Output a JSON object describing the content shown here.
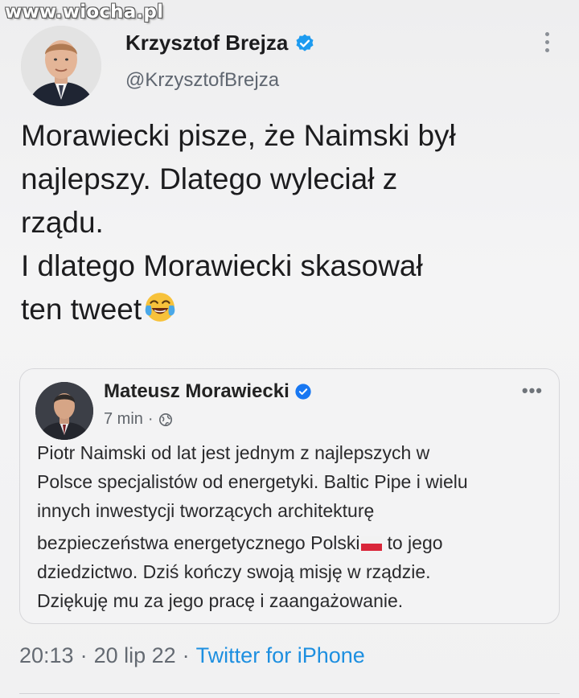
{
  "watermark": "www.wiocha.pl",
  "tweet": {
    "author_name": "Krzysztof Brejza",
    "author_handle": "@KrzysztofBrejza",
    "text_lines": [
      "Morawiecki pisze, że Naimski był",
      "najlepszy. Dlatego wyleciał z",
      "rządu.",
      "I dlatego Morawiecki skasował",
      "ten tweet"
    ],
    "emoji": "face-with-tears-of-joy-icon",
    "time": "20:13",
    "date": "20 lip 22",
    "source": "Twitter for iPhone",
    "separator": "·"
  },
  "quoted_post": {
    "author_name": "Mateusz Morawiecki",
    "time_ago": "7 min",
    "meta_separator": "·",
    "privacy_icon": "globe-icon",
    "more_label": "•••",
    "text_lines": [
      "Piotr Naimski od lat jest jednym z najlepszych w",
      "Polsce specjalistów od energetyki. Baltic Pipe i wielu",
      "innych inwestycji tworzących architekturę",
      "bezpieczeństwa energetycznego Polski",
      "to jego",
      "dziedzictwo. Dziś kończy swoją misję w rządzie.",
      "Dziękuję mu za jego pracę i zaangażowanie."
    ]
  },
  "colors": {
    "accent_blue": "#1d8fe0",
    "verified_blue": "#1d9bf0",
    "text": "#1c1c1e",
    "muted": "#5f6670"
  }
}
